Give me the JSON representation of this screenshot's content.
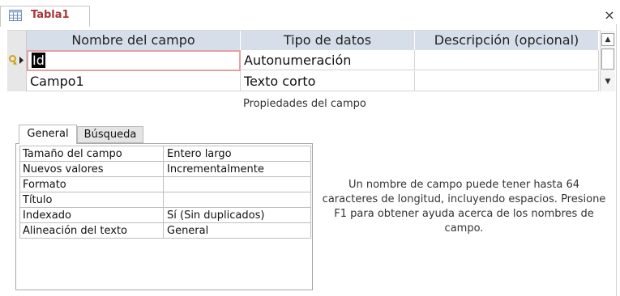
{
  "document_tab": {
    "title": "Tabla1",
    "icon": "table-icon",
    "close": "×"
  },
  "colors": {
    "accent": "#a4373a",
    "header_bg": "#d6dfe9",
    "active_border": "#e1a3a3",
    "key_icon": "#d4a017"
  },
  "grid": {
    "headers": [
      "Nombre del campo",
      "Tipo de datos",
      "Descripción (opcional)"
    ],
    "rows": [
      {
        "name": "Id",
        "type": "Autonumeración",
        "description": "",
        "primary_key": true,
        "current": true
      },
      {
        "name": "Campo1",
        "type": "Texto corto",
        "description": "",
        "primary_key": false,
        "current": false
      }
    ]
  },
  "scrollbar": {
    "up": "▲",
    "down": "▼"
  },
  "properties": {
    "section_label": "Propiedades del campo",
    "tabs": [
      "General",
      "Búsqueda"
    ],
    "active_tab": "General",
    "rows": [
      {
        "name": "Tamaño del campo",
        "value": "Entero largo"
      },
      {
        "name": "Nuevos valores",
        "value": "Incrementalmente"
      },
      {
        "name": "Formato",
        "value": ""
      },
      {
        "name": "Título",
        "value": ""
      },
      {
        "name": "Indexado",
        "value": "Sí (Sin duplicados)"
      },
      {
        "name": "Alineación del texto",
        "value": "General"
      }
    ]
  },
  "help_text": "Un nombre de campo puede tener hasta 64 caracteres de longitud, incluyendo espacios. Presione F1 para obtener ayuda acerca de los nombres de campo."
}
